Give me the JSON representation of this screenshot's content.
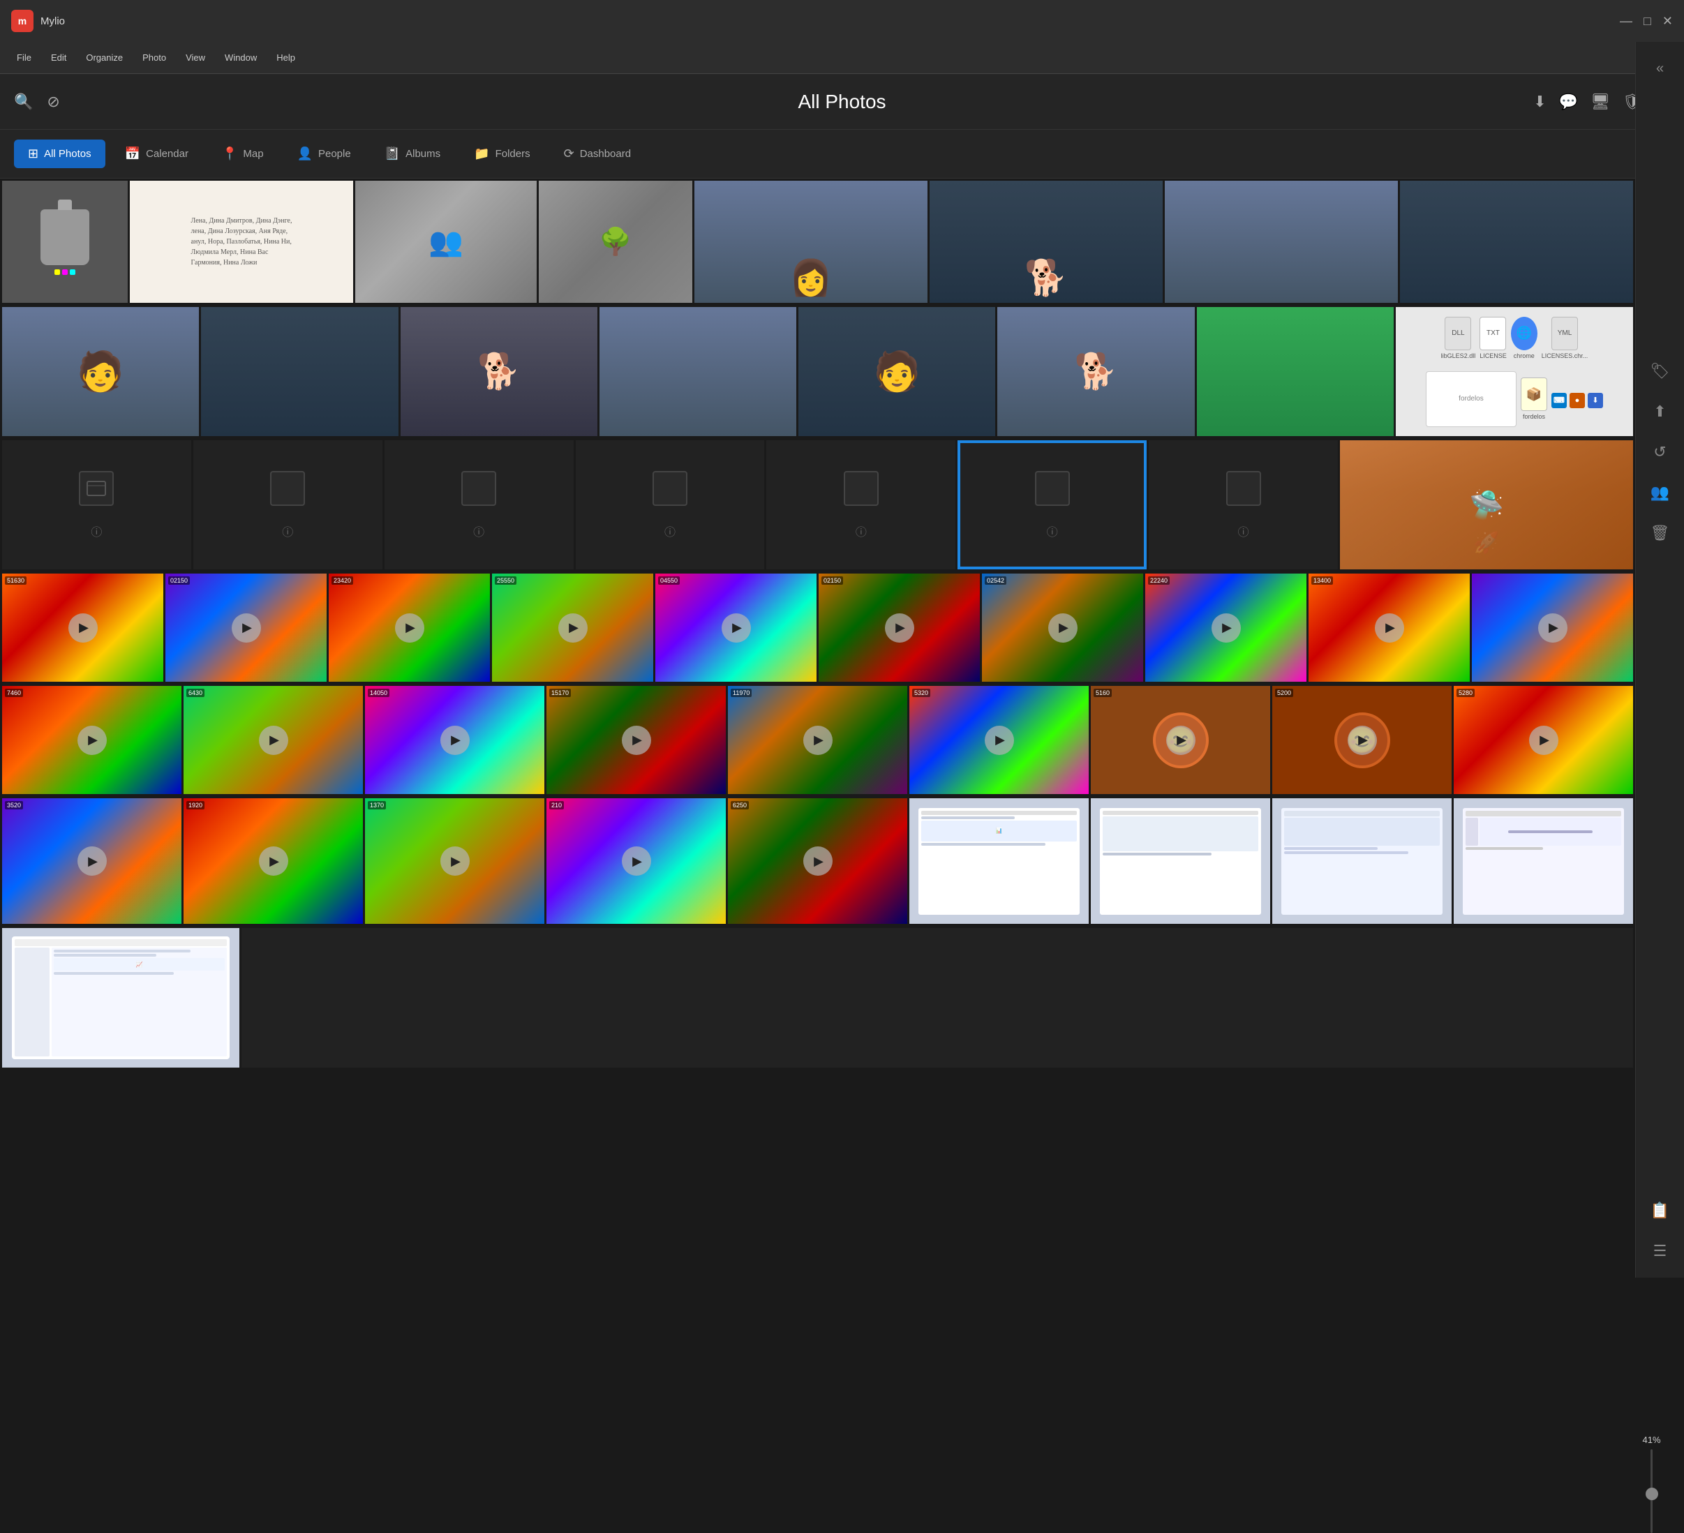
{
  "app": {
    "name": "Mylio",
    "logo_text": "m"
  },
  "title_bar": {
    "minimize": "—",
    "maximize": "□",
    "close": "✕"
  },
  "menu": {
    "items": [
      "File",
      "Edit",
      "Organize",
      "Photo",
      "View",
      "Window",
      "Help"
    ]
  },
  "toolbar": {
    "title": "All Photos",
    "search_icon": "🔍",
    "filter_icon": "⊘"
  },
  "nav": {
    "tabs": [
      {
        "id": "all-photos",
        "label": "All Photos",
        "icon": "⊞",
        "active": true
      },
      {
        "id": "calendar",
        "label": "Calendar",
        "icon": "📅",
        "active": false
      },
      {
        "id": "map",
        "label": "Map",
        "icon": "📍",
        "active": false
      },
      {
        "id": "people",
        "label": "People",
        "icon": "👤",
        "active": false
      },
      {
        "id": "albums",
        "label": "Albums",
        "icon": "📓",
        "active": false
      },
      {
        "id": "folders",
        "label": "Folders",
        "icon": "📁",
        "active": false
      },
      {
        "id": "dashboard",
        "label": "Dashboard",
        "icon": "⟳",
        "active": false
      }
    ]
  },
  "right_sidebar": {
    "icons": [
      {
        "id": "collapse",
        "icon": "«"
      },
      {
        "id": "tag",
        "icon": "🏷"
      },
      {
        "id": "upload",
        "icon": "⬆"
      },
      {
        "id": "rotate",
        "icon": "↺"
      },
      {
        "id": "people-add",
        "icon": "👥"
      },
      {
        "id": "delete",
        "icon": "🗑"
      }
    ]
  },
  "zoom": {
    "percent": "41%"
  },
  "grid": {
    "rows": [
      {
        "id": "row-portraits-bw",
        "items": [
          {
            "type": "object-gray",
            "label": "weight object"
          },
          {
            "type": "text-handwriting",
            "label": "handwritten text"
          },
          {
            "type": "bw-group",
            "label": "black white group photo"
          },
          {
            "type": "bw-outdoor",
            "label": "black white outdoor photo"
          },
          {
            "type": "portrait-dog-1",
            "label": "woman with pomeranian dog"
          },
          {
            "type": "portrait-dog-2",
            "label": "woman selfie with dog"
          }
        ]
      },
      {
        "id": "row-portraits",
        "items": [
          {
            "type": "portrait-1",
            "label": "woman portrait"
          },
          {
            "type": "portrait-2",
            "label": "woman portrait"
          },
          {
            "type": "portrait-dog-3",
            "label": "woman with dog"
          },
          {
            "type": "portrait-3",
            "label": "woman portrait"
          },
          {
            "type": "portrait-4",
            "label": "woman portrait close"
          },
          {
            "type": "portrait-dog-4",
            "label": "woman holding dog"
          },
          {
            "type": "portrait-dog-5",
            "label": "woman with dog"
          },
          {
            "type": "files-bg",
            "label": "file icons"
          }
        ]
      },
      {
        "id": "row-blank-mars",
        "items": [
          {
            "type": "blank-1",
            "label": "blank"
          },
          {
            "type": "blank-2",
            "label": "blank"
          },
          {
            "type": "blank-3",
            "label": "blank"
          },
          {
            "type": "blank-4",
            "label": "blank"
          },
          {
            "type": "blank-5",
            "label": "blank"
          },
          {
            "type": "blank-selected",
            "label": "blank selected"
          },
          {
            "type": "blank-6",
            "label": "blank"
          },
          {
            "type": "mars-rover",
            "label": "mars rover image"
          }
        ]
      },
      {
        "id": "row-retro-1",
        "items": [
          {
            "type": "retro-game",
            "color": "retro-1",
            "label": "retro game 1"
          },
          {
            "type": "retro-game",
            "color": "retro-2",
            "label": "retro game 2"
          },
          {
            "type": "retro-game",
            "color": "retro-3",
            "label": "retro game 3"
          },
          {
            "type": "retro-game",
            "color": "retro-4",
            "label": "retro game 4"
          },
          {
            "type": "retro-game",
            "color": "retro-5",
            "label": "retro game 5"
          },
          {
            "type": "retro-game",
            "color": "retro-6",
            "label": "retro game 6"
          },
          {
            "type": "retro-game",
            "color": "retro-7",
            "label": "retro game 7"
          },
          {
            "type": "retro-game",
            "color": "retro-8",
            "label": "retro game 8"
          },
          {
            "type": "retro-game",
            "color": "retro-1",
            "label": "retro game 9"
          },
          {
            "type": "retro-game",
            "color": "retro-2",
            "label": "retro game 10"
          }
        ]
      },
      {
        "id": "row-retro-2",
        "items": [
          {
            "type": "retro-game",
            "color": "retro-3",
            "label": "retro game 11"
          },
          {
            "type": "retro-game",
            "color": "retro-4",
            "label": "retro game 12"
          },
          {
            "type": "retro-game",
            "color": "retro-5",
            "label": "retro game 13"
          },
          {
            "type": "retro-game",
            "color": "retro-6",
            "label": "retro game 14"
          },
          {
            "type": "retro-game",
            "color": "retro-7",
            "label": "retro game 15"
          },
          {
            "type": "retro-game",
            "color": "retro-8",
            "label": "retro game 16"
          },
          {
            "type": "retro-smiley",
            "color": "retro-smiley",
            "label": "retro smiley"
          },
          {
            "type": "retro-smiley",
            "color": "retro-smiley",
            "label": "retro smiley 2"
          },
          {
            "type": "retro-game",
            "color": "retro-1",
            "label": "retro game 17"
          }
        ]
      },
      {
        "id": "row-retro-3",
        "items": [
          {
            "type": "retro-game",
            "color": "retro-2",
            "label": "retro game 18"
          },
          {
            "type": "retro-game",
            "color": "retro-3",
            "label": "retro game 19"
          },
          {
            "type": "retro-game",
            "color": "retro-4",
            "label": "retro game 20"
          },
          {
            "type": "retro-game",
            "color": "retro-5",
            "label": "retro game 21"
          },
          {
            "type": "retro-game",
            "color": "retro-6",
            "label": "retro game 22"
          },
          {
            "type": "screenshot",
            "label": "screenshot 1"
          },
          {
            "type": "screenshot",
            "label": "screenshot 2"
          },
          {
            "type": "screenshot",
            "label": "screenshot 3"
          },
          {
            "type": "screenshot",
            "label": "screenshot 4"
          }
        ]
      },
      {
        "id": "row-last",
        "items": [
          {
            "type": "screenshot",
            "label": "screenshot 5"
          }
        ]
      }
    ]
  }
}
